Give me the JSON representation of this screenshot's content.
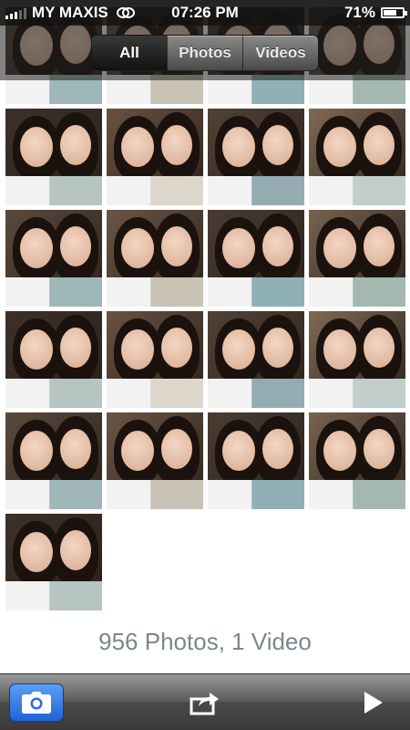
{
  "status": {
    "carrier": "MY MAXIS",
    "time": "07:26 PM",
    "battery": "71%",
    "battery_level": 0.71,
    "icons": [
      "signal-bars-icon",
      "sync-icon",
      "battery-icon"
    ]
  },
  "nav": {
    "segments": [
      "All",
      "Photos",
      "Videos"
    ],
    "active": "All"
  },
  "summary": "956 Photos, 1 Video",
  "toolbar": {
    "icons": [
      "camera-icon",
      "share-icon",
      "play-slideshow-icon"
    ],
    "accent_color": "#2f7de8"
  },
  "grid": {
    "thumbnails_visible": 21
  }
}
